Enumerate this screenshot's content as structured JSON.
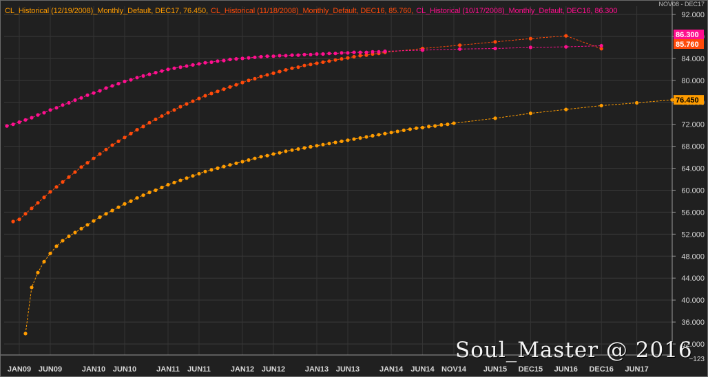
{
  "legend": [
    {
      "text": "CL_Historical (12/19/2008)_Monthly_Default, DEC17, 76.450,",
      "color": "#ff9c00"
    },
    {
      "text": "CL_Historical (11/18/2008)_Monthly_Default, DEC16, 85.760,",
      "color": "#ff4a0a"
    },
    {
      "text": "CL_Historical (10/17/2008)_Monthly_Default, DEC16, 86.300",
      "color": "#ff0f8e"
    }
  ],
  "top_right_label": "NOV08 - DEC17",
  "axis_corner_label": "−123",
  "watermark": "Soul_Master @ 2016",
  "chart_data": {
    "type": "line",
    "x_ticks": [
      "JAN09",
      "JUN09",
      "JAN10",
      "JUN10",
      "JAN11",
      "JUN11",
      "JAN12",
      "JUN12",
      "JAN13",
      "JUN13",
      "JAN14",
      "JUN14",
      "NOV14",
      "JUN15",
      "DEC15",
      "JUN16",
      "DEC16",
      "JUN17"
    ],
    "y_ticks": [
      "32.000",
      "36.000",
      "40.000",
      "44.000",
      "48.000",
      "52.000",
      "56.000",
      "60.000",
      "64.000",
      "68.000",
      "72.000",
      "76.000",
      "80.000",
      "84.000",
      "88.000",
      "92.000"
    ],
    "ylim": [
      30,
      93.5
    ],
    "grid": true,
    "legend_position": "top-left",
    "series": [
      {
        "name": "CL_Historical (12/19/2008)_Monthly_Default",
        "color": "#ff9c00",
        "last_label": "76.450",
        "points": [
          [
            "FEB09",
            33.9
          ],
          [
            "MAR09",
            42.3
          ],
          [
            "APR09",
            45.0
          ],
          [
            "MAY09",
            47.0
          ],
          [
            "JUN09",
            48.5
          ],
          [
            "JUL09",
            49.8
          ],
          [
            "AUG09",
            50.8
          ],
          [
            "SEP09",
            51.6
          ],
          [
            "OCT09",
            52.3
          ],
          [
            "NOV09",
            53.0
          ],
          [
            "DEC09",
            53.7
          ],
          [
            "JAN10",
            54.4
          ],
          [
            "FEB10",
            55.1
          ],
          [
            "MAR10",
            55.7
          ],
          [
            "APR10",
            56.3
          ],
          [
            "MAY10",
            56.9
          ],
          [
            "JUN10",
            57.5
          ],
          [
            "JUL10",
            58.0
          ],
          [
            "AUG10",
            58.6
          ],
          [
            "SEP10",
            59.1
          ],
          [
            "OCT10",
            59.6
          ],
          [
            "NOV10",
            60.0
          ],
          [
            "DEC10",
            60.5
          ],
          [
            "JAN11",
            61.0
          ],
          [
            "FEB11",
            61.4
          ],
          [
            "MAR11",
            61.8
          ],
          [
            "APR11",
            62.2
          ],
          [
            "MAY11",
            62.6
          ],
          [
            "JUN11",
            63.0
          ],
          [
            "JUL11",
            63.4
          ],
          [
            "AUG11",
            63.7
          ],
          [
            "SEP11",
            64.0
          ],
          [
            "OCT11",
            64.3
          ],
          [
            "NOV11",
            64.6
          ],
          [
            "DEC11",
            64.9
          ],
          [
            "JAN12",
            65.2
          ],
          [
            "FEB12",
            65.5
          ],
          [
            "MAR12",
            65.8
          ],
          [
            "APR12",
            66.1
          ],
          [
            "MAY12",
            66.3
          ],
          [
            "JUN12",
            66.6
          ],
          [
            "JUL12",
            66.8
          ],
          [
            "AUG12",
            67.1
          ],
          [
            "SEP12",
            67.3
          ],
          [
            "OCT12",
            67.5
          ],
          [
            "NOV12",
            67.7
          ],
          [
            "DEC12",
            67.9
          ],
          [
            "JAN13",
            68.1
          ],
          [
            "FEB13",
            68.3
          ],
          [
            "MAR13",
            68.5
          ],
          [
            "APR13",
            68.7
          ],
          [
            "MAY13",
            68.9
          ],
          [
            "JUN13",
            69.1
          ],
          [
            "JUL13",
            69.3
          ],
          [
            "AUG13",
            69.5
          ],
          [
            "SEP13",
            69.7
          ],
          [
            "OCT13",
            69.9
          ],
          [
            "NOV13",
            70.1
          ],
          [
            "DEC13",
            70.3
          ],
          [
            "JAN14",
            70.5
          ],
          [
            "FEB14",
            70.7
          ],
          [
            "MAR14",
            70.9
          ],
          [
            "APR14",
            71.1
          ],
          [
            "MAY14",
            71.3
          ],
          [
            "JUN14",
            71.4
          ],
          [
            "JUL14",
            71.6
          ],
          [
            "AUG14",
            71.7
          ],
          [
            "SEP14",
            71.9
          ],
          [
            "OCT14",
            72.0
          ],
          [
            "NOV14",
            72.2
          ],
          [
            "JUN15",
            73.1
          ],
          [
            "DEC15",
            74.0
          ],
          [
            "JUN16",
            74.7
          ],
          [
            "DEC16",
            75.4
          ],
          [
            "JUN17",
            75.9
          ],
          [
            "DEC17",
            76.45
          ]
        ]
      },
      {
        "name": "CL_Historical (11/18/2008)_Monthly_Default",
        "color": "#ff4a0a",
        "last_label": "85.760",
        "points": [
          [
            "DEC08",
            54.3
          ],
          [
            "JAN09",
            54.7
          ],
          [
            "FEB09",
            55.7
          ],
          [
            "MAR09",
            56.7
          ],
          [
            "APR09",
            57.7
          ],
          [
            "MAY09",
            58.7
          ],
          [
            "JUN09",
            59.7
          ],
          [
            "JUL09",
            60.6
          ],
          [
            "AUG09",
            61.5
          ],
          [
            "SEP09",
            62.4
          ],
          [
            "OCT09",
            63.3
          ],
          [
            "NOV09",
            64.2
          ],
          [
            "DEC09",
            65.0
          ],
          [
            "JAN10",
            65.8
          ],
          [
            "FEB10",
            66.6
          ],
          [
            "MAR10",
            67.4
          ],
          [
            "APR10",
            68.2
          ],
          [
            "MAY10",
            68.9
          ],
          [
            "JUN10",
            69.6
          ],
          [
            "JUL10",
            70.3
          ],
          [
            "AUG10",
            71.0
          ],
          [
            "SEP10",
            71.6
          ],
          [
            "OCT10",
            72.3
          ],
          [
            "NOV10",
            72.9
          ],
          [
            "DEC10",
            73.5
          ],
          [
            "JAN11",
            74.1
          ],
          [
            "FEB11",
            74.6
          ],
          [
            "MAR11",
            75.2
          ],
          [
            "APR11",
            75.7
          ],
          [
            "MAY11",
            76.2
          ],
          [
            "JUN11",
            76.7
          ],
          [
            "JUL11",
            77.2
          ],
          [
            "AUG11",
            77.6
          ],
          [
            "SEP11",
            78.0
          ],
          [
            "OCT11",
            78.4
          ],
          [
            "NOV11",
            78.8
          ],
          [
            "DEC11",
            79.2
          ],
          [
            "JAN12",
            79.6
          ],
          [
            "FEB12",
            80.0
          ],
          [
            "MAR12",
            80.3
          ],
          [
            "APR12",
            80.7
          ],
          [
            "MAY12",
            81.0
          ],
          [
            "JUN12",
            81.3
          ],
          [
            "JUL12",
            81.6
          ],
          [
            "AUG12",
            81.9
          ],
          [
            "SEP12",
            82.2
          ],
          [
            "OCT12",
            82.4
          ],
          [
            "NOV12",
            82.7
          ],
          [
            "DEC12",
            82.9
          ],
          [
            "JAN13",
            83.1
          ],
          [
            "FEB13",
            83.3
          ],
          [
            "MAR13",
            83.5
          ],
          [
            "APR13",
            83.7
          ],
          [
            "MAY13",
            83.9
          ],
          [
            "JUN13",
            84.1
          ],
          [
            "JUL13",
            84.3
          ],
          [
            "AUG13",
            84.5
          ],
          [
            "SEP13",
            84.6
          ],
          [
            "OCT13",
            84.8
          ],
          [
            "NOV13",
            84.9
          ],
          [
            "DEC13",
            85.1
          ],
          [
            "JUN14",
            85.8
          ],
          [
            "DEC14",
            86.4
          ],
          [
            "JUN15",
            87.0
          ],
          [
            "DEC15",
            87.6
          ],
          [
            "JUN16",
            88.1
          ],
          [
            "DEC16",
            85.76
          ]
        ]
      },
      {
        "name": "CL_Historical (10/17/2008)_Monthly_Default",
        "color": "#ff0f8e",
        "last_label": "86.300",
        "points": [
          [
            "NOV08",
            71.7
          ],
          [
            "DEC08",
            72.0
          ],
          [
            "JAN09",
            72.4
          ],
          [
            "FEB09",
            72.8
          ],
          [
            "MAR09",
            73.2
          ],
          [
            "APR09",
            73.7
          ],
          [
            "MAY09",
            74.1
          ],
          [
            "JUN09",
            74.6
          ],
          [
            "JUL09",
            75.0
          ],
          [
            "AUG09",
            75.5
          ],
          [
            "SEP09",
            75.9
          ],
          [
            "OCT09",
            76.4
          ],
          [
            "NOV09",
            76.8
          ],
          [
            "DEC09",
            77.3
          ],
          [
            "JAN10",
            77.7
          ],
          [
            "FEB10",
            78.1
          ],
          [
            "MAR10",
            78.6
          ],
          [
            "APR10",
            79.0
          ],
          [
            "MAY10",
            79.4
          ],
          [
            "JUN10",
            79.8
          ],
          [
            "JUL10",
            80.1
          ],
          [
            "AUG10",
            80.5
          ],
          [
            "SEP10",
            80.8
          ],
          [
            "OCT10",
            81.1
          ],
          [
            "NOV10",
            81.4
          ],
          [
            "DEC10",
            81.7
          ],
          [
            "JAN11",
            82.0
          ],
          [
            "FEB11",
            82.2
          ],
          [
            "MAR11",
            82.4
          ],
          [
            "APR11",
            82.6
          ],
          [
            "MAY11",
            82.8
          ],
          [
            "JUN11",
            83.0
          ],
          [
            "JUL11",
            83.2
          ],
          [
            "AUG11",
            83.3
          ],
          [
            "SEP11",
            83.5
          ],
          [
            "OCT11",
            83.6
          ],
          [
            "NOV11",
            83.8
          ],
          [
            "DEC11",
            83.9
          ],
          [
            "JAN12",
            84.0
          ],
          [
            "FEB12",
            84.1
          ],
          [
            "MAR12",
            84.2
          ],
          [
            "APR12",
            84.3
          ],
          [
            "MAY12",
            84.4
          ],
          [
            "JUN12",
            84.4
          ],
          [
            "JUL12",
            84.5
          ],
          [
            "AUG12",
            84.5
          ],
          [
            "SEP12",
            84.6
          ],
          [
            "OCT12",
            84.6
          ],
          [
            "NOV12",
            84.7
          ],
          [
            "DEC12",
            84.7
          ],
          [
            "JAN13",
            84.8
          ],
          [
            "FEB13",
            84.8
          ],
          [
            "MAR13",
            84.9
          ],
          [
            "APR13",
            84.9
          ],
          [
            "MAY13",
            85.0
          ],
          [
            "JUN13",
            85.0
          ],
          [
            "JUL13",
            85.1
          ],
          [
            "AUG13",
            85.1
          ],
          [
            "SEP13",
            85.1
          ],
          [
            "OCT13",
            85.2
          ],
          [
            "NOV13",
            85.2
          ],
          [
            "DEC13",
            85.3
          ],
          [
            "JUN14",
            85.5
          ],
          [
            "DEC14",
            85.7
          ],
          [
            "JUN15",
            85.8
          ],
          [
            "DEC15",
            86.0
          ],
          [
            "JUN16",
            86.1
          ],
          [
            "DEC16",
            86.3
          ]
        ]
      }
    ]
  }
}
